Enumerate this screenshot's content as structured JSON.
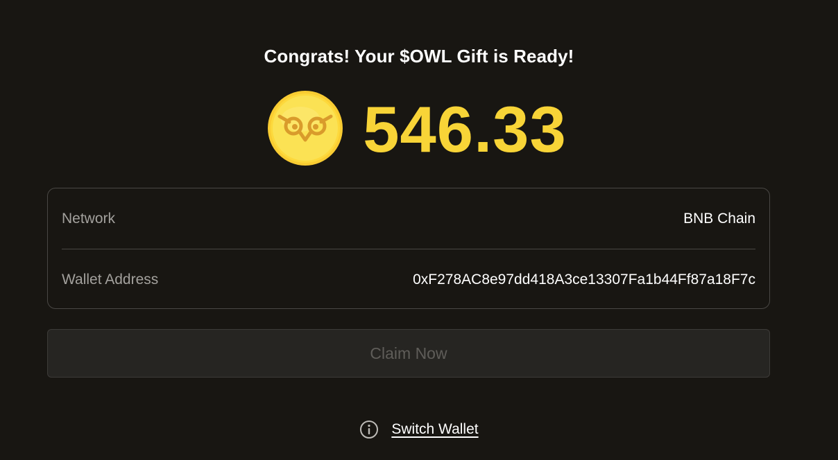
{
  "gift": {
    "title": "Congrats! Your $OWL Gift is Ready!",
    "amount": "546.33",
    "coin_icon": "owl-coin-icon"
  },
  "details": {
    "network_label": "Network",
    "network_value": "BNB Chain",
    "wallet_label": "Wallet Address",
    "wallet_value": "0xF278AC8e97dd418A3ce13307Fa1b44Ff87a18F7c"
  },
  "actions": {
    "claim_label": "Claim Now",
    "switch_wallet_label": "Switch Wallet",
    "info_icon": "info-circle-icon"
  },
  "colors": {
    "background": "#181612",
    "accent_yellow": "#f8d437",
    "card_border": "#4a4845",
    "muted_text": "#a3a19d",
    "button_bg": "#262522",
    "button_text_disabled": "#5f5d59"
  }
}
